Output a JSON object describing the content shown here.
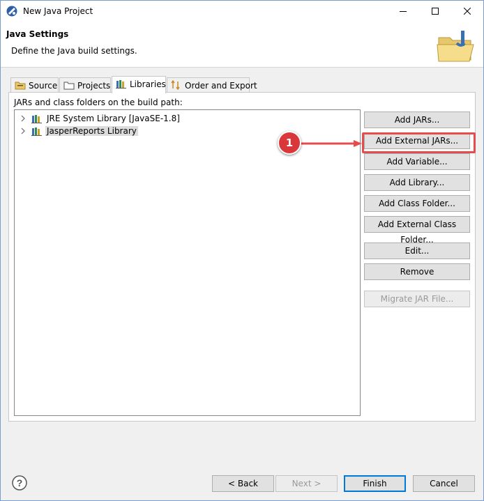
{
  "window": {
    "title": "New Java Project"
  },
  "header": {
    "title": "Java Settings",
    "description": "Define the Java build settings."
  },
  "tabs": [
    {
      "label": "Source",
      "icon": "source-folder-icon"
    },
    {
      "label": "Projects",
      "icon": "projects-folder-icon"
    },
    {
      "label": "Libraries",
      "icon": "libraries-icon",
      "active": true
    },
    {
      "label": "Order and Export",
      "icon": "order-export-icon"
    }
  ],
  "libraries": {
    "label": "JARs and class folders on the build path:",
    "items": [
      {
        "label": "JRE System Library [JavaSE-1.8]",
        "selected": false
      },
      {
        "label": "JasperReports Library",
        "selected": true
      }
    ],
    "buttons": {
      "add_jars": "Add JARs...",
      "add_external_jars": "Add External JARs...",
      "add_variable": "Add Variable...",
      "add_library": "Add Library...",
      "add_class_folder": "Add Class Folder...",
      "add_external_class_folder": "Add External Class Folder...",
      "edit": "Edit...",
      "remove": "Remove",
      "migrate_jar": "Migrate JAR File..."
    }
  },
  "annotation": {
    "step_number": "1",
    "color": "#e74c4c"
  },
  "footer": {
    "back": "< Back",
    "next": "Next >",
    "finish": "Finish",
    "cancel": "Cancel",
    "help_icon": "help-icon"
  }
}
